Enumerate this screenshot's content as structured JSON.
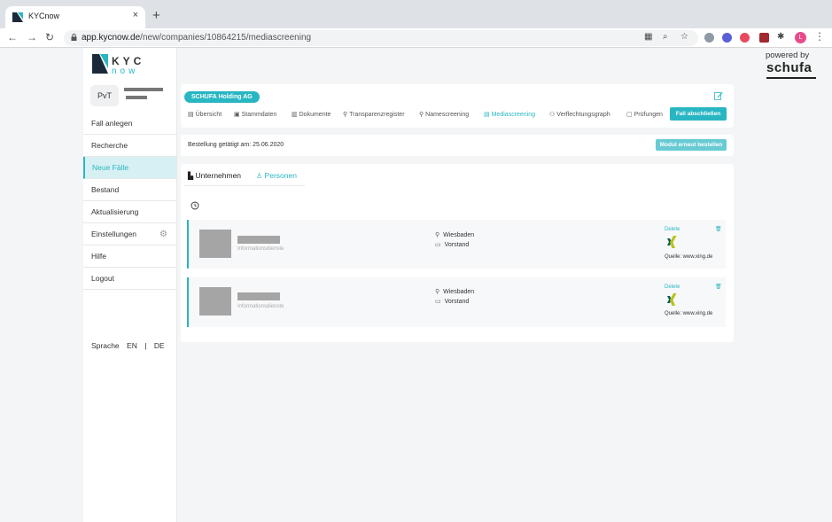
{
  "browser": {
    "tab_title": "KYCnow",
    "close_glyph": "×",
    "new_tab_glyph": "+",
    "url_host": "app.kycnow.de",
    "url_path": "/new/companies/10864215/mediascreening",
    "extension_letter": "L"
  },
  "logo": {
    "name": "KYC",
    "sub": "now"
  },
  "brand": {
    "powered_by": "powered by",
    "schufa": "schufa"
  },
  "sidebar": {
    "avatar_initials": "PvT",
    "items": [
      {
        "label": "Fall anlegen"
      },
      {
        "label": "Recherche"
      },
      {
        "label": "Neue Fälle"
      },
      {
        "label": "Bestand"
      },
      {
        "label": "Aktualisierung"
      },
      {
        "label": "Einstellungen"
      },
      {
        "label": "Hilfe"
      },
      {
        "label": "Logout"
      }
    ],
    "language_label": "Sprache",
    "lang_en": "EN",
    "lang_sep": "|",
    "lang_de": "DE"
  },
  "company": {
    "name": "SCHUFA Holding AG"
  },
  "tabs": [
    {
      "label": "Übersicht",
      "icon": "overview-icon"
    },
    {
      "label": "Stammdaten",
      "icon": "master-data-icon"
    },
    {
      "label": "Dokumente",
      "icon": "documents-icon"
    },
    {
      "label": "Transparenzregister",
      "icon": "register-icon"
    },
    {
      "label": "Namescreening",
      "icon": "namescreening-icon"
    },
    {
      "label": "Mediascreening",
      "icon": "mediascreening-icon"
    },
    {
      "label": "Verflechtungsgraph",
      "icon": "graph-icon"
    },
    {
      "label": "Prüfungen",
      "icon": "checks-icon"
    }
  ],
  "buttons": {
    "close_case": "Fall abschließen",
    "reorder": "Modul erneut bestellen"
  },
  "order": {
    "text": "Bestellung getätigt am: 25.06.2020"
  },
  "subtabs": {
    "companies": "Unternehmen",
    "persons": "Personen"
  },
  "results": [
    {
      "subtitle": "Informationsdienste",
      "city": "Wiesbaden",
      "role": "Vorstand",
      "delete": "Delete",
      "source": "Quelle: www.xing.de"
    },
    {
      "subtitle": "Informationsdienste",
      "city": "Wiesbaden",
      "role": "Vorstand",
      "delete": "Delete",
      "source": "Quelle: www.xing.de"
    }
  ],
  "colors": {
    "accent": "#29b6c3",
    "xing_green": "#b7c316",
    "xing_dark": "#0a5d5e"
  }
}
